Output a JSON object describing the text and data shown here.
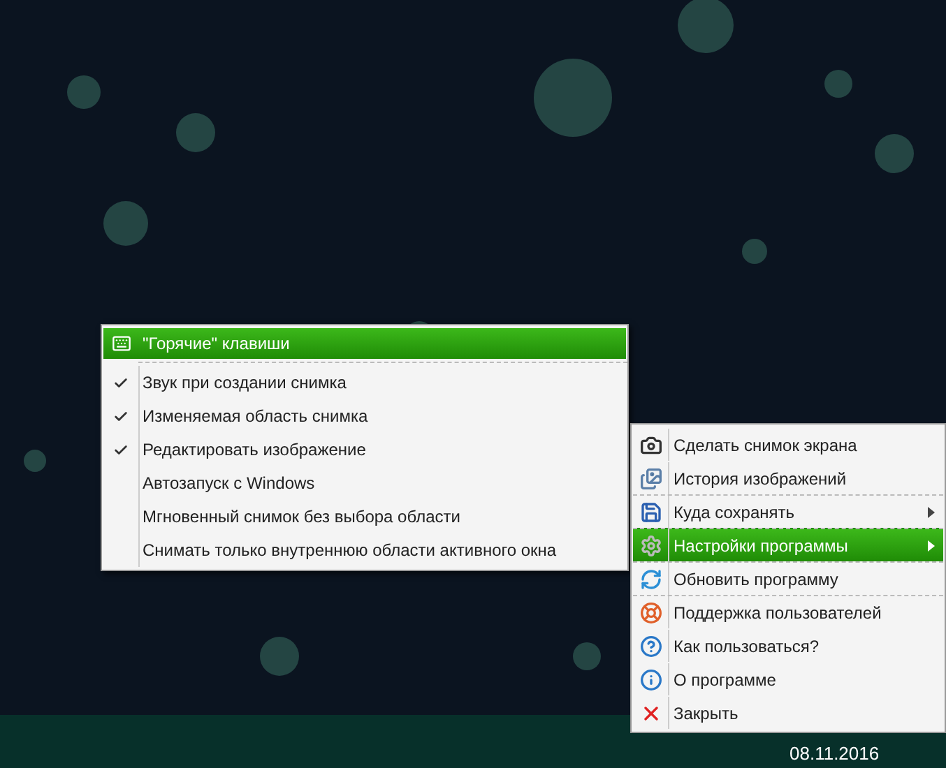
{
  "settings_submenu": {
    "items": [
      {
        "kind": "action",
        "label": "\"Горячие\" клавиши",
        "selected": true
      },
      {
        "kind": "toggle",
        "label": "Звук при создании снимка",
        "checked": true,
        "selected": false
      },
      {
        "kind": "toggle",
        "label": "Изменяемая область снимка",
        "checked": true,
        "selected": false
      },
      {
        "kind": "toggle",
        "label": "Редактировать изображение",
        "checked": true,
        "selected": false
      },
      {
        "kind": "toggle",
        "label": "Автозапуск с Windows",
        "checked": false,
        "selected": false
      },
      {
        "kind": "toggle",
        "label": "Мгновенный снимок без выбора области",
        "checked": false,
        "selected": false
      },
      {
        "kind": "toggle",
        "label": "Снимать только внутреннюю области активного окна",
        "checked": false,
        "selected": false
      }
    ]
  },
  "tray_menu": {
    "items": [
      {
        "label": "Сделать снимок экрана",
        "selected": false,
        "has_submenu": false,
        "separator_before": false
      },
      {
        "label": "История изображений",
        "selected": false,
        "has_submenu": false,
        "separator_before": false
      },
      {
        "label": "Куда сохранять",
        "selected": false,
        "has_submenu": true,
        "separator_before": true
      },
      {
        "label": "Настройки программы",
        "selected": true,
        "has_submenu": true,
        "separator_before": true
      },
      {
        "label": "Обновить программу",
        "selected": false,
        "has_submenu": false,
        "separator_before": true
      },
      {
        "label": "Поддержка пользователей",
        "selected": false,
        "has_submenu": false,
        "separator_before": true
      },
      {
        "label": "Как пользоваться?",
        "selected": false,
        "has_submenu": false,
        "separator_before": false
      },
      {
        "label": "О программе",
        "selected": false,
        "has_submenu": false,
        "separator_before": false
      },
      {
        "label": "Закрыть",
        "selected": false,
        "has_submenu": false,
        "separator_before": false
      }
    ]
  },
  "taskbar": {
    "date": "08.11.2016"
  }
}
